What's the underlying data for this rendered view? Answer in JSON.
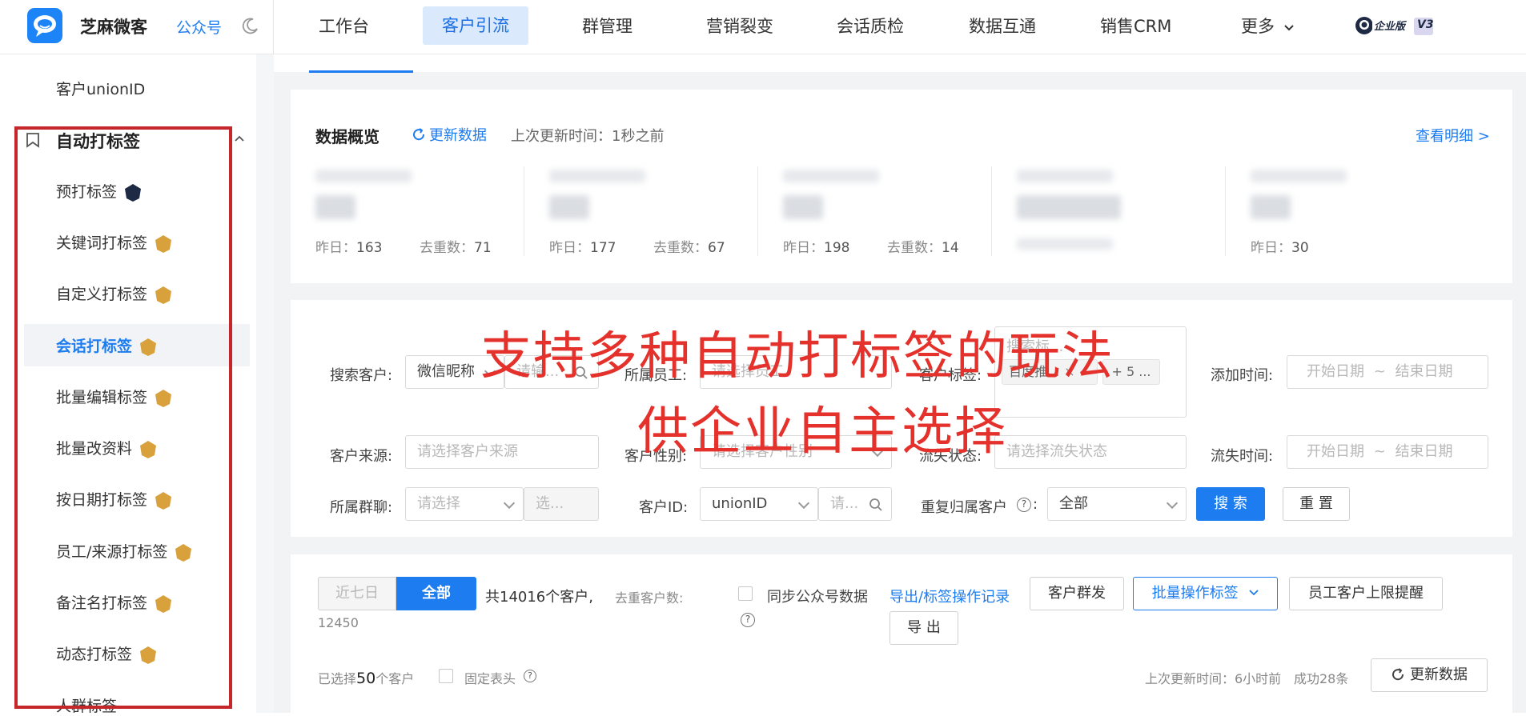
{
  "header": {
    "brand": "芝麻微客",
    "gzh": "公众号",
    "nav": [
      "工作台",
      "客户引流",
      "群管理",
      "营销裂变",
      "会话质检",
      "数据互通",
      "销售CRM",
      "更多"
    ],
    "nav_active": "客户引流",
    "edition_label": "企业版",
    "edition_version": "V3"
  },
  "sidebar": {
    "top_item": "客户unionID",
    "section_title": "自动打标签",
    "items": [
      {
        "label": "预打标签",
        "badge": "V3"
      },
      {
        "label": "关键词打标签",
        "badge": "V2"
      },
      {
        "label": "自定义打标签",
        "badge": "V2"
      },
      {
        "label": "会话打标签",
        "badge": "V2",
        "active": true
      },
      {
        "label": "批量编辑标签",
        "badge": "V2"
      },
      {
        "label": "批量改资料",
        "badge": "V2"
      },
      {
        "label": "按日期打标签",
        "badge": "V2"
      },
      {
        "label": "员工/来源打标签",
        "badge": "V2"
      },
      {
        "label": "备注名打标签",
        "badge": "V2"
      },
      {
        "label": "动态打标签",
        "badge": "V2"
      },
      {
        "label": "人群标签",
        "badge": ""
      }
    ]
  },
  "overview": {
    "title": "数据概览",
    "refresh": "更新数据",
    "updated": "上次更新时间：1秒之前",
    "detail": "查看明细 >",
    "stats": [
      {
        "yesterday_label": "昨日：",
        "yesterday": "163",
        "dedup_label": "去重数：",
        "dedup": "71"
      },
      {
        "yesterday_label": "昨日：",
        "yesterday": "177",
        "dedup_label": "去重数：",
        "dedup": "67"
      },
      {
        "yesterday_label": "昨日：",
        "yesterday": "198",
        "dedup_label": "去重数：",
        "dedup": "14"
      },
      {
        "yesterday_label": "",
        "yesterday": "",
        "dedup_label": "",
        "dedup": ""
      },
      {
        "yesterday_label": "昨日：",
        "yesterday": "30",
        "dedup_label": "",
        "dedup": ""
      }
    ]
  },
  "filters": {
    "search_customer": "搜索客户:",
    "search_type": "微信昵称",
    "search_ph": "请输...",
    "staff": "所属员工:",
    "staff_ph": "请选择员工",
    "tag": "客户标签:",
    "tag_value": "百度推...",
    "tag_more": "+ 5 ...",
    "tag_partial": "搜索标...",
    "add_time": "添加时间:",
    "date_start": "开始日期",
    "date_sep": "~",
    "date_end": "结束日期",
    "source": "客户来源:",
    "source_ph": "请选择客户来源",
    "gender": "客户性别:",
    "gender_ph": "请选择客户性别",
    "churn_status": "流失状态:",
    "churn_ph": "请选择流失状态",
    "churn_time": "流失时间:",
    "group": "所属群聊:",
    "group_ph": "请选择",
    "group_sel": "选...",
    "cust_id": "客户ID:",
    "cust_id_type": "unionID",
    "cust_id_ph": "请...",
    "repeat": "重复归属客户",
    "repeat_value": "全部",
    "search_btn": "搜 索",
    "reset_btn": "重 置"
  },
  "overlay": {
    "line1": "支持多种自动打标签的玩法",
    "line2": "供企业自主选择"
  },
  "list": {
    "seg_7d": "近七日",
    "seg_all": "全部",
    "total": "共14016个客户,",
    "dedup_label": "去重客户数:",
    "dedup_value": "12450",
    "sync_label": "同步公众号数据",
    "export_log": "导出/标签操作记录",
    "group_send": "客户群发",
    "batch_tag": "批量操作标签",
    "limit_remind": "员工客户上限提醒",
    "export": "导 出",
    "selected_pre": "已选择",
    "selected_num": "50",
    "selected_post": "个客户",
    "fixed_header": "固定表头",
    "last_update": "上次更新时间：6小时前",
    "success": "成功28条",
    "refresh": "更新数据"
  },
  "colors": {
    "brand_blue": "#1c7cf0",
    "highlight_red": "#c4262a",
    "overlay_red": "#e4312b",
    "badge_gold": "#d9a13b"
  }
}
